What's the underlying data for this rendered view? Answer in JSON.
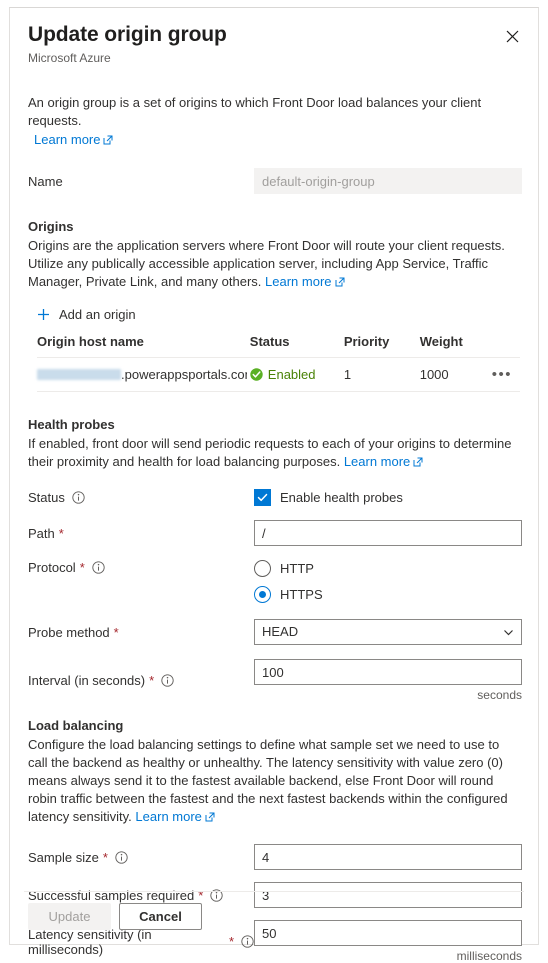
{
  "header": {
    "title": "Update origin group",
    "subtitle": "Microsoft Azure",
    "close_label": "Close"
  },
  "intro": {
    "text": "An origin group is a set of origins to which Front Door load balances your client requests.",
    "learn_more": "Learn more"
  },
  "name_field": {
    "label": "Name",
    "value": "default-origin-group"
  },
  "origins": {
    "title": "Origins",
    "description": "Origins are the application servers where Front Door will route your client requests. Utilize any publically accessible application server, including App Service, Traffic Manager, Private Link, and many others.",
    "learn_more": "Learn more",
    "add_button": "Add an origin",
    "columns": [
      "Origin host name",
      "Status",
      "Priority",
      "Weight"
    ],
    "rows": [
      {
        "host_redacted": true,
        "host_suffix": ".powerappsportals.com",
        "status": "Enabled",
        "status_color": "#498205",
        "priority": "1",
        "weight": "1000",
        "more_label": "•••"
      }
    ]
  },
  "health_probes": {
    "title": "Health probes",
    "description": "If enabled, front door will send periodic requests to each of your origins to determine their proximity and health for load balancing purposes.",
    "learn_more": "Learn more",
    "status_label": "Status",
    "enable_label": "Enable health probes",
    "enabled": true,
    "path_label": "Path",
    "path_value": "/",
    "protocol_label": "Protocol",
    "protocol_options": [
      "HTTP",
      "HTTPS"
    ],
    "protocol_selected": "HTTPS",
    "probe_method_label": "Probe method",
    "probe_method_value": "HEAD",
    "interval_label": "Interval (in seconds)",
    "interval_value": "100",
    "interval_unit": "seconds"
  },
  "load_balancing": {
    "title": "Load balancing",
    "description": "Configure the load balancing settings to define what sample set we need to use to call the backend as healthy or unhealthy. The latency sensitivity with value zero (0) means always send it to the fastest available backend, else Front Door will round robin traffic between the fastest and the next fastest backends within the configured latency sensitivity.",
    "learn_more": "Learn more",
    "sample_size_label": "Sample size",
    "sample_size_value": "4",
    "successful_samples_label": "Successful samples required",
    "successful_samples_value": "3",
    "latency_label": "Latency sensitivity (in milliseconds)",
    "latency_value": "50",
    "latency_unit": "milliseconds"
  },
  "footer": {
    "update_label": "Update",
    "cancel_label": "Cancel"
  },
  "colors": {
    "accent": "#0078d4",
    "required": "#a4262c",
    "success": "#498205",
    "disabled_bg": "#f3f2f1"
  }
}
